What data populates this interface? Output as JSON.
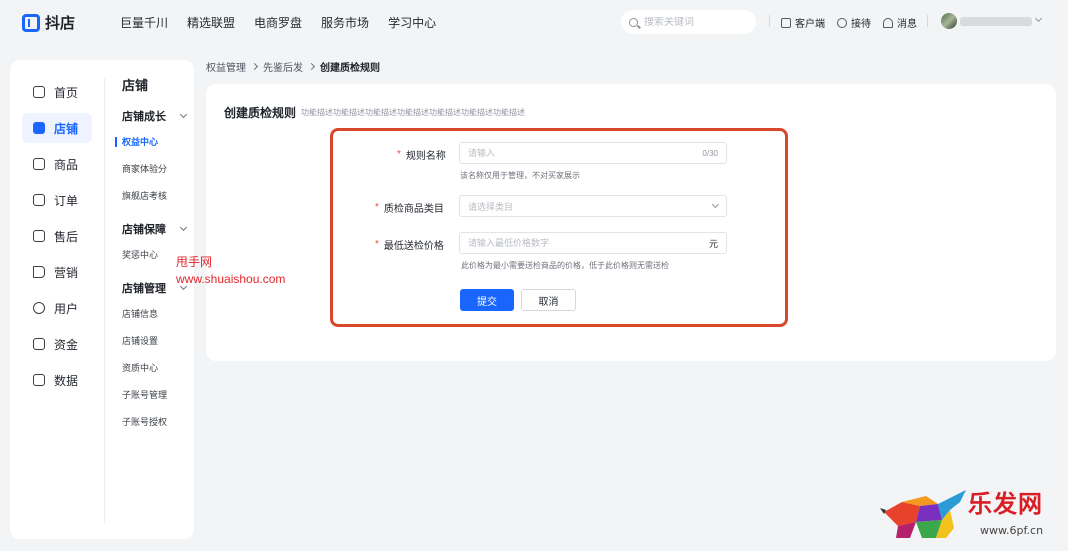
{
  "app": {
    "logo_text": "抖店"
  },
  "topnav": [
    "巨量千川",
    "精选联盟",
    "电商罗盘",
    "服务市场",
    "学习中心"
  ],
  "search": {
    "placeholder": "搜索关键词"
  },
  "tools": {
    "client": "客户端",
    "service": "接待",
    "message": "消息"
  },
  "main_nav": [
    {
      "label": "首页",
      "icon": "home-icon"
    },
    {
      "label": "店铺",
      "icon": "shop-icon",
      "active": true
    },
    {
      "label": "商品",
      "icon": "bag-icon"
    },
    {
      "label": "订单",
      "icon": "order-icon"
    },
    {
      "label": "售后",
      "icon": "aftersale-icon"
    },
    {
      "label": "营销",
      "icon": "megaphone-icon"
    },
    {
      "label": "用户",
      "icon": "user-icon"
    },
    {
      "label": "资金",
      "icon": "wallet-icon"
    },
    {
      "label": "数据",
      "icon": "chart-icon"
    }
  ],
  "sub_nav": {
    "title": "店铺",
    "groups": [
      {
        "label": "店铺成长",
        "items": [
          "权益中心",
          "商家体验分",
          "旗舰店考核"
        ]
      },
      {
        "label": "店铺保障",
        "items": [
          "奖惩中心"
        ]
      },
      {
        "label": "店铺管理",
        "items": [
          "店铺信息",
          "店铺设置",
          "资质中心",
          "子账号管理",
          "子账号授权"
        ]
      }
    ]
  },
  "breadcrumb": [
    "权益管理",
    "先鉴后发",
    "创建质检规则"
  ],
  "page": {
    "title": "创建质检规则",
    "desc": "功能描述功能描述功能描述功能描述功能描述功能描述功能描述"
  },
  "form": {
    "rule_name": {
      "label": "规则名称",
      "placeholder": "请输入",
      "counter": "0/30",
      "hint": "该名称仅用于管理，不对买家展示"
    },
    "category": {
      "label": "质检商品类目",
      "placeholder": "请选择类目"
    },
    "min_price": {
      "label": "最低送检价格",
      "placeholder": "请输入最低价格数字",
      "suffix": "元",
      "hint": "此价格为最小需要送检商品的价格，低于此价格则无需送检"
    },
    "required_mark": "*",
    "submit": "提交",
    "cancel": "取消"
  },
  "watermarks": {
    "line1": "甩手网",
    "line2": "www.shuaishou.com",
    "logo_name": "乐发网",
    "logo_url": "www.6pf.cn"
  },
  "colors": {
    "accent": "#1966ff",
    "highlight": "#d9472b",
    "required": "#e34d3e"
  }
}
